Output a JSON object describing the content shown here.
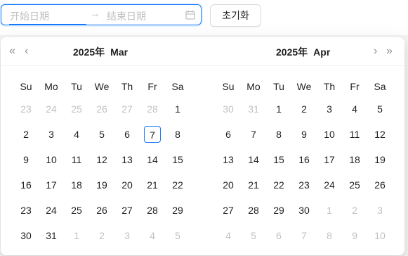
{
  "range_picker": {
    "start_placeholder": "开始日期",
    "separator": "→",
    "end_placeholder": "结束日期"
  },
  "reset_button": {
    "label": "초기화"
  },
  "panel": {
    "weekdays": [
      "Su",
      "Mo",
      "Tu",
      "We",
      "Th",
      "Fr",
      "Sa"
    ],
    "left": {
      "year": "2025年",
      "month": "Mar",
      "weeks": [
        [
          {
            "d": "23",
            "o": 1
          },
          {
            "d": "24",
            "o": 1
          },
          {
            "d": "25",
            "o": 1
          },
          {
            "d": "26",
            "o": 1
          },
          {
            "d": "27",
            "o": 1
          },
          {
            "d": "28",
            "o": 1
          },
          {
            "d": "1",
            "o": 0
          }
        ],
        [
          {
            "d": "2",
            "o": 0
          },
          {
            "d": "3",
            "o": 0
          },
          {
            "d": "4",
            "o": 0
          },
          {
            "d": "5",
            "o": 0
          },
          {
            "d": "6",
            "o": 0
          },
          {
            "d": "7",
            "o": 0,
            "today": 1
          },
          {
            "d": "8",
            "o": 0
          }
        ],
        [
          {
            "d": "9",
            "o": 0
          },
          {
            "d": "10",
            "o": 0
          },
          {
            "d": "11",
            "o": 0
          },
          {
            "d": "12",
            "o": 0
          },
          {
            "d": "13",
            "o": 0
          },
          {
            "d": "14",
            "o": 0
          },
          {
            "d": "15",
            "o": 0
          }
        ],
        [
          {
            "d": "16",
            "o": 0
          },
          {
            "d": "17",
            "o": 0
          },
          {
            "d": "18",
            "o": 0
          },
          {
            "d": "19",
            "o": 0
          },
          {
            "d": "20",
            "o": 0
          },
          {
            "d": "21",
            "o": 0
          },
          {
            "d": "22",
            "o": 0
          }
        ],
        [
          {
            "d": "23",
            "o": 0
          },
          {
            "d": "24",
            "o": 0
          },
          {
            "d": "25",
            "o": 0
          },
          {
            "d": "26",
            "o": 0
          },
          {
            "d": "27",
            "o": 0
          },
          {
            "d": "28",
            "o": 0
          },
          {
            "d": "29",
            "o": 0
          }
        ],
        [
          {
            "d": "30",
            "o": 0
          },
          {
            "d": "31",
            "o": 0
          },
          {
            "d": "1",
            "o": 1
          },
          {
            "d": "2",
            "o": 1
          },
          {
            "d": "3",
            "o": 1
          },
          {
            "d": "4",
            "o": 1
          },
          {
            "d": "5",
            "o": 1
          }
        ]
      ]
    },
    "right": {
      "year": "2025年",
      "month": "Apr",
      "weeks": [
        [
          {
            "d": "30",
            "o": 1
          },
          {
            "d": "31",
            "o": 1
          },
          {
            "d": "1",
            "o": 0
          },
          {
            "d": "2",
            "o": 0
          },
          {
            "d": "3",
            "o": 0
          },
          {
            "d": "4",
            "o": 0
          },
          {
            "d": "5",
            "o": 0
          }
        ],
        [
          {
            "d": "6",
            "o": 0
          },
          {
            "d": "7",
            "o": 0
          },
          {
            "d": "8",
            "o": 0
          },
          {
            "d": "9",
            "o": 0
          },
          {
            "d": "10",
            "o": 0
          },
          {
            "d": "11",
            "o": 0
          },
          {
            "d": "12",
            "o": 0
          }
        ],
        [
          {
            "d": "13",
            "o": 0
          },
          {
            "d": "14",
            "o": 0
          },
          {
            "d": "15",
            "o": 0
          },
          {
            "d": "16",
            "o": 0
          },
          {
            "d": "17",
            "o": 0
          },
          {
            "d": "18",
            "o": 0
          },
          {
            "d": "19",
            "o": 0
          }
        ],
        [
          {
            "d": "20",
            "o": 0
          },
          {
            "d": "21",
            "o": 0
          },
          {
            "d": "22",
            "o": 0
          },
          {
            "d": "23",
            "o": 0
          },
          {
            "d": "24",
            "o": 0
          },
          {
            "d": "25",
            "o": 0
          },
          {
            "d": "26",
            "o": 0
          }
        ],
        [
          {
            "d": "27",
            "o": 0
          },
          {
            "d": "28",
            "o": 0
          },
          {
            "d": "29",
            "o": 0
          },
          {
            "d": "30",
            "o": 0
          },
          {
            "d": "1",
            "o": 1
          },
          {
            "d": "2",
            "o": 1
          },
          {
            "d": "3",
            "o": 1
          }
        ],
        [
          {
            "d": "4",
            "o": 1
          },
          {
            "d": "5",
            "o": 1
          },
          {
            "d": "6",
            "o": 1
          },
          {
            "d": "7",
            "o": 1
          },
          {
            "d": "8",
            "o": 1
          },
          {
            "d": "9",
            "o": 1
          },
          {
            "d": "10",
            "o": 1
          }
        ]
      ]
    },
    "nav": {
      "super_prev": "«",
      "prev": "‹",
      "next": "›",
      "super_next": "»"
    }
  },
  "colors": {
    "primary": "#1677ff",
    "disabled_text": "#bfbfbf",
    "out_of_month_text": "rgba(0,0,0,0.25)"
  }
}
